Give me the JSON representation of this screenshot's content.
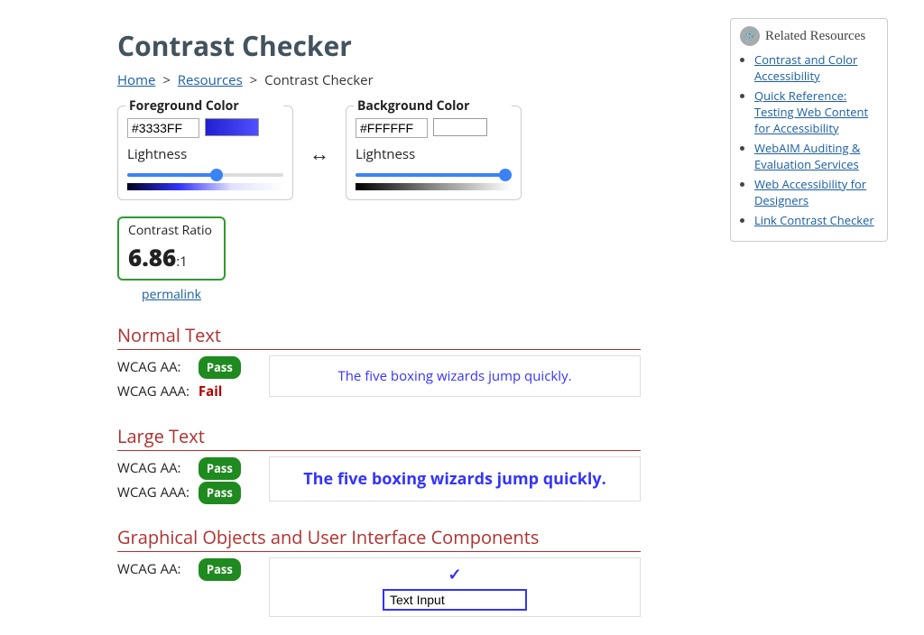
{
  "page_title": "Contrast Checker",
  "breadcrumb": {
    "home": "Home",
    "resources": "Resources",
    "current": "Contrast Checker",
    "sep": ">"
  },
  "foreground": {
    "label": "Foreground Color",
    "hex": "#3333FF",
    "lightness_label": "Lightness",
    "slider_percent": 58
  },
  "background": {
    "label": "Background Color",
    "hex": "#FFFFFF",
    "lightness_label": "Lightness",
    "slider_percent": 100
  },
  "swap_symbol": "↔",
  "ratio": {
    "title": "Contrast Ratio",
    "value": "6.86",
    "suffix": ":1",
    "permalink": "permalink"
  },
  "sections": {
    "normal": {
      "title": "Normal Text",
      "aa_label": "WCAG AA:",
      "aa_result": "Pass",
      "aaa_label": "WCAG AAA:",
      "aaa_result": "Fail",
      "sample": "The five boxing wizards jump quickly."
    },
    "large": {
      "title": "Large Text",
      "aa_label": "WCAG AA:",
      "aa_result": "Pass",
      "aaa_label": "WCAG AAA:",
      "aaa_result": "Pass",
      "sample": "The five boxing wizards jump quickly."
    },
    "ui": {
      "title": "Graphical Objects and User Interface Components",
      "aa_label": "WCAG AA:",
      "aa_result": "Pass",
      "check": "✓",
      "input_value": "Text Input"
    }
  },
  "sidebar": {
    "title": "Related Resources",
    "items": [
      "Contrast and Color Accessibility",
      "Quick Reference: Testing Web Content for Accessibility",
      "WebAIM Auditing & Evaluation Services",
      "Web Accessibility for Designers",
      "Link Contrast Checker"
    ]
  },
  "colors": {
    "fg_swatch": "linear-gradient(to right,#2020d0,#5050ff)",
    "fg_gradient": "linear-gradient(to right,#000020,#3333FF,#e0e0ff,#ffffff)",
    "bg_swatch": "#ffffff",
    "bg_gradient": "linear-gradient(to right,#000000,#888888,#ffffff)"
  }
}
